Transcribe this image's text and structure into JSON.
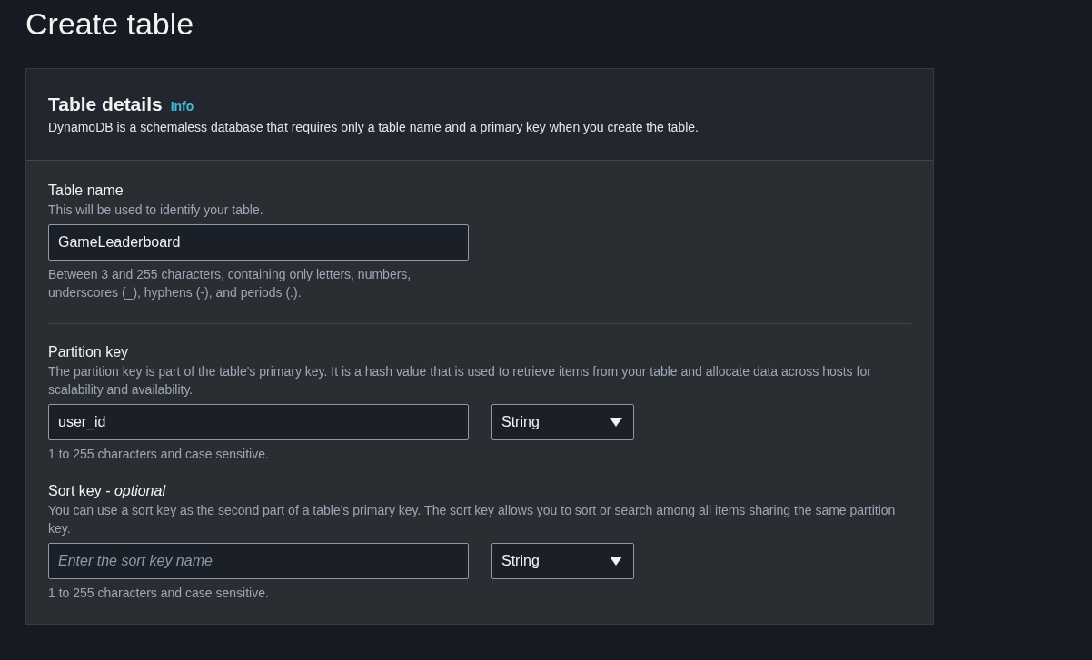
{
  "page_title": "Create table",
  "panel": {
    "title": "Table details",
    "info_link": "Info",
    "description": "DynamoDB is a schemaless database that requires only a table name and a primary key when you create the table."
  },
  "fields": [
    {
      "label": "Table name",
      "description": "This will be used to identify your table.",
      "value": "GameLeaderboard",
      "constraint": "Between 3 and 255 characters, containing only letters, numbers, underscores (_), hyphens (-), and periods (.).",
      "divider_after": true
    },
    {
      "label": "Partition key",
      "description": "The partition key is part of the table's primary key. It is a hash value that is used to retrieve items from your table and allocate data across hosts for scalability and availability.",
      "value": "user_id",
      "type_select": "String",
      "constraint": "1 to 255 characters and case sensitive."
    },
    {
      "label": "Sort key - *optional*",
      "description": "You can use a sort key as the second part of a table's primary key. The sort key allows you to sort or search among all items sharing the same partition key.",
      "placeholder": "Enter the sort key name",
      "type_select": "String",
      "constraint": "1 to 255 characters and case sensitive."
    }
  ]
}
